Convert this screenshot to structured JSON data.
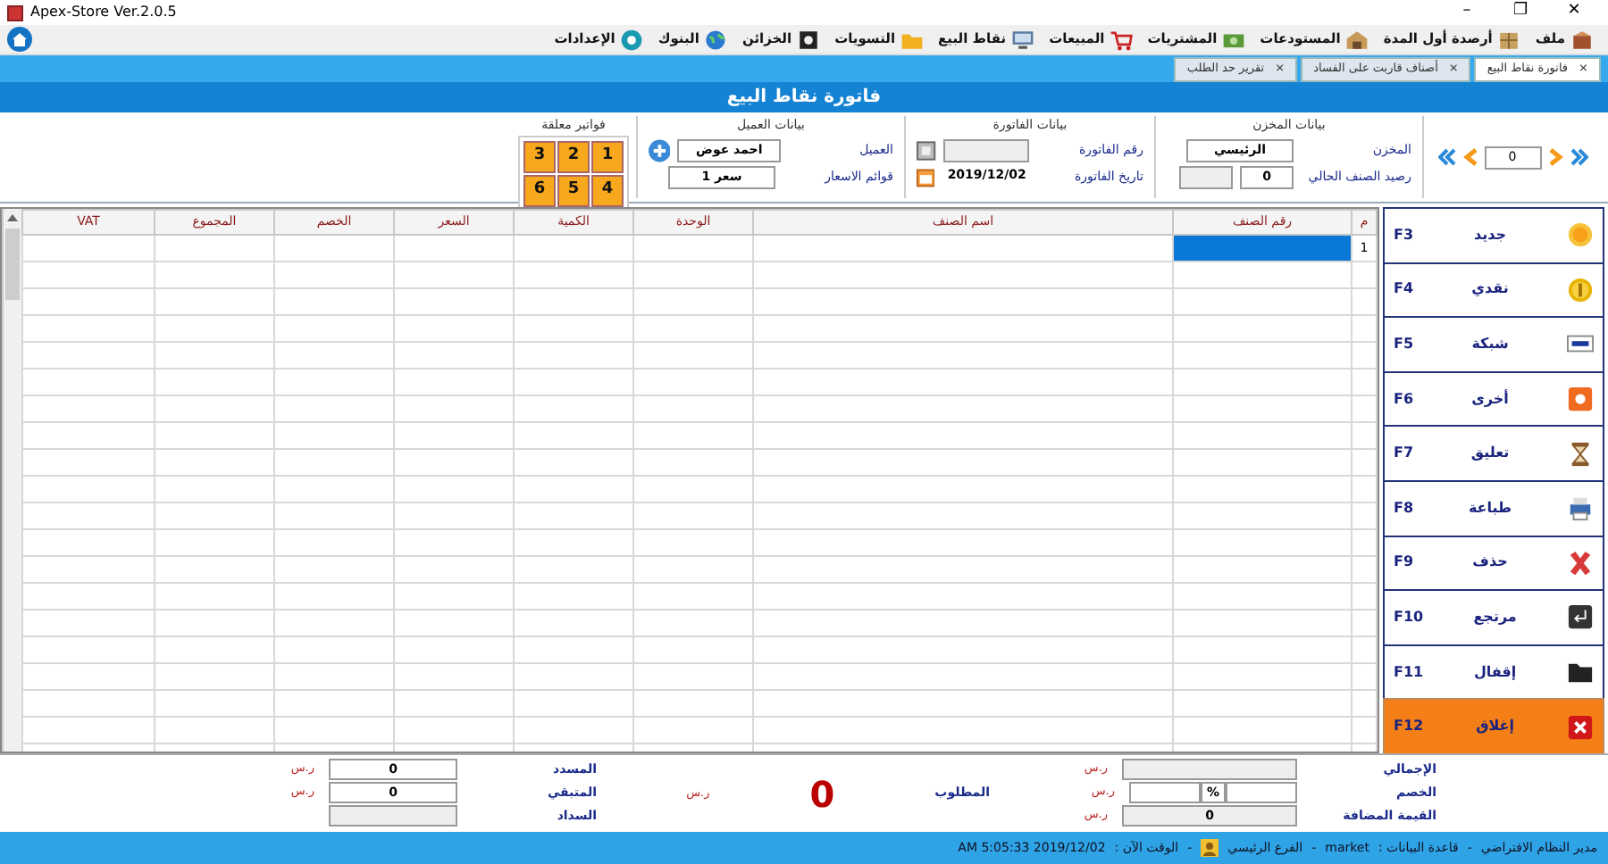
{
  "window": {
    "title": "Apex-Store Ver.2.0.5",
    "controls": [
      "✕",
      "❐",
      "–"
    ]
  },
  "menu": [
    {
      "label": "ملف",
      "kind": "box"
    },
    {
      "label": "أرصدة أول المدة",
      "kind": "crate"
    },
    {
      "label": "المستودعات",
      "kind": "warehouse"
    },
    {
      "label": "المشتريات",
      "kind": "cash"
    },
    {
      "label": "المبيعات",
      "kind": "cart"
    },
    {
      "label": "نقاط البيع",
      "kind": "monitor"
    },
    {
      "label": "التسويات",
      "kind": "folder"
    },
    {
      "label": "الخزائن",
      "kind": "safe"
    },
    {
      "label": "البنوك",
      "kind": "globe"
    },
    {
      "label": "الإعدادات",
      "kind": "gear"
    }
  ],
  "tabs": [
    {
      "label": "فاتورة نقاط البيع",
      "close": "×",
      "selected": true
    },
    {
      "label": "أصناف قاربت على الفساد",
      "close": "×",
      "selected": false
    },
    {
      "label": "تقرير حد الطلب",
      "close": "×",
      "selected": false
    }
  ],
  "page_title": "فاتورة نقاط البيع",
  "navigator": {
    "value": "0"
  },
  "store": {
    "title": "بيانات المخزن",
    "store_label": "المخزن",
    "store_value": "الرئيسي",
    "balance_label": "رصيد الصنف الحالي",
    "balance_value": "0"
  },
  "invoice": {
    "title": "بيانات الفاتورة",
    "number_label": "رقم الفاتورة",
    "date_label": "تاريخ الفاتورة",
    "date_value": "2019/12/02"
  },
  "customer": {
    "title": "بيانات العميل",
    "customer_label": "العميل",
    "customer_value": "احمد عوض",
    "price_list_label": "قوائم الاسعار",
    "price_list_value": "سعر 1"
  },
  "pending": {
    "title": "فواتير معلقة",
    "slots": [
      "1",
      "2",
      "3",
      "4",
      "5",
      "6"
    ]
  },
  "table": {
    "columns": [
      "م",
      "رقم الصنف",
      "اسم الصنف",
      "الوحدة",
      "الكمية",
      "السعر",
      "الخصم",
      "المجموع",
      "VAT"
    ],
    "rows": [
      {
        "number": "1",
        "selected": true
      }
    ]
  },
  "actions": [
    {
      "label": "جديد",
      "key": "F3",
      "kind": "new",
      "highlighted": false
    },
    {
      "label": "نقدي",
      "key": "F4",
      "kind": "coin",
      "highlighted": false
    },
    {
      "label": "شبكة",
      "key": "F5",
      "kind": "card",
      "highlighted": false
    },
    {
      "label": "أخرى",
      "key": "F6",
      "kind": "other",
      "highlighted": false
    },
    {
      "label": "تعليق",
      "key": "F7",
      "kind": "hourglass",
      "highlighted": false
    },
    {
      "label": "طباعة",
      "key": "F8",
      "kind": "printer",
      "highlighted": false
    },
    {
      "label": "حذف",
      "key": "F9",
      "kind": "delete",
      "highlighted": false
    },
    {
      "label": "مرتجع",
      "key": "F10",
      "kind": "return",
      "highlighted": false
    },
    {
      "label": "إقفال",
      "key": "F11",
      "kind": "folder-dark",
      "highlighted": false
    },
    {
      "label": "إغلاق",
      "key": "F12",
      "kind": "close",
      "highlighted": true
    }
  ],
  "totals": {
    "total_label": "الإجمالي",
    "total_currency": "ر.س",
    "discount_label": "الخصم",
    "discount_percent": "%",
    "discount_currency": "ر.س",
    "vat_label": "القيمة المضافة",
    "vat_value": "0",
    "vat_currency": "ر.س",
    "due_label": "المطلوب",
    "due_value": "0",
    "due_currency": "ر.س",
    "paid_label": "المسدد",
    "paid_value": "0",
    "paid_currency": "ر.س",
    "remaining_label": "المتبقي",
    "remaining_value": "0",
    "remaining_currency": "ر.س",
    "payment_label": "السداد"
  },
  "status_bar": [
    "مدير النظام الافتراضي",
    "-",
    "قاعدة البيانات :",
    "market",
    "-",
    "الفرع الرئيسي",
    "-",
    "الوقت الآن :",
    "AM 5:05:33 2019/12/02"
  ]
}
